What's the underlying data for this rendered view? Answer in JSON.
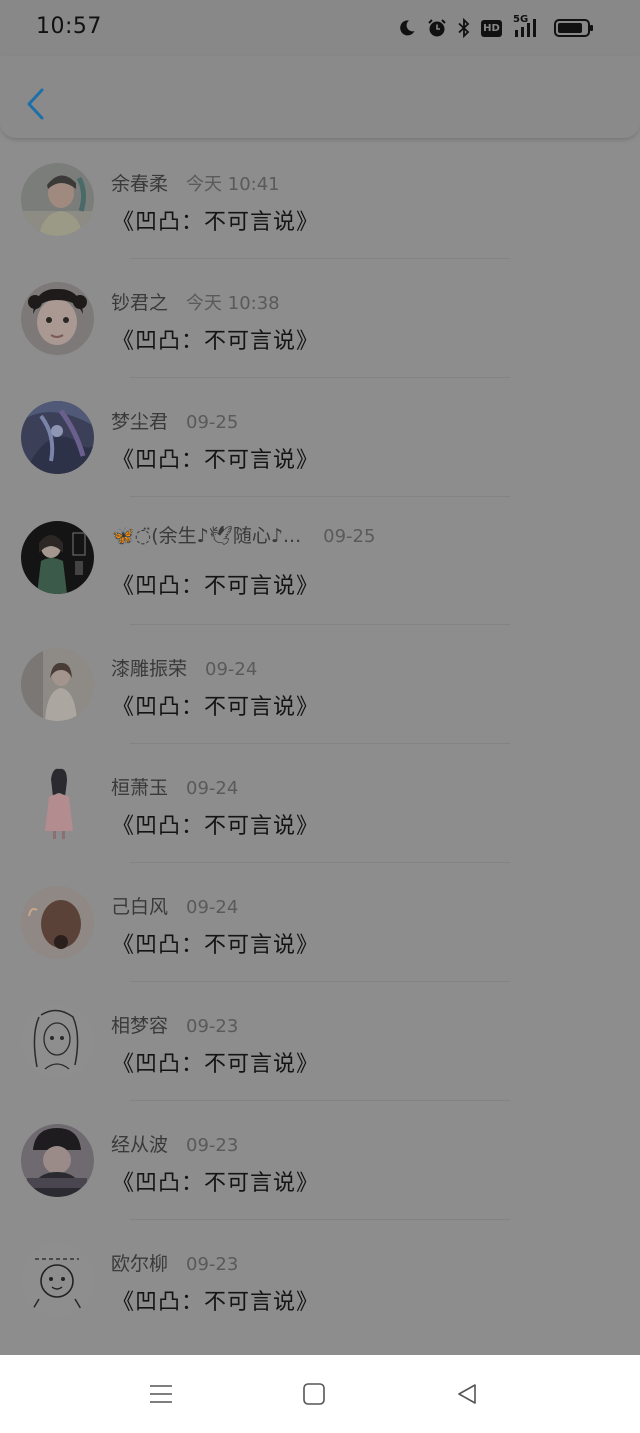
{
  "status_bar": {
    "time": "10:57",
    "icons": [
      "moon-icon",
      "alarm-clock-icon",
      "bluetooth-icon",
      "hd-icon",
      "5g-signal-icon",
      "battery-icon"
    ],
    "hd_label": "HD",
    "network_label": "5G"
  },
  "header": {
    "back_icon": "chevron-left-icon",
    "accent_color": "#1c6fa8"
  },
  "message_list": [
    {
      "name": "余春柔",
      "time": "今天 10:41",
      "message": "《凹凸：不可言说》",
      "avatar": "avatar-boy-sweater"
    },
    {
      "name": "钞君之",
      "time": "今天 10:38",
      "message": "《凹凸：不可言说》",
      "avatar": "avatar-child-portrait"
    },
    {
      "name": "梦尘君",
      "time": "09-25",
      "message": "《凹凸：不可言说》",
      "avatar": "avatar-fantasy-art"
    },
    {
      "name": "🦋◌̈(余生♪🕊随心♪...",
      "time": "09-25",
      "message": "《凹凸：不可言说》",
      "avatar": "avatar-girl-green-dress"
    },
    {
      "name": "漆雕振荣",
      "time": "09-24",
      "message": "《凹凸：不可言说》",
      "avatar": "avatar-woman-room"
    },
    {
      "name": "桓萧玉",
      "time": "09-24",
      "message": "《凹凸：不可言说》",
      "avatar": "avatar-girl-pink-dress"
    },
    {
      "name": "己白风",
      "time": "09-24",
      "message": "《凹凸：不可言说》",
      "avatar": "avatar-hair-back"
    },
    {
      "name": "相梦容",
      "time": "09-23",
      "message": "《凹凸：不可言说》",
      "avatar": "avatar-sketch-girl"
    },
    {
      "name": "经从波",
      "time": "09-23",
      "message": "《凹凸：不可言说》",
      "avatar": "avatar-girl-hat"
    },
    {
      "name": "欧尔柳",
      "time": "09-23",
      "message": "《凹凸：不可言说》",
      "avatar": "avatar-doodle"
    }
  ],
  "nav_bar": {
    "buttons": [
      "menu-icon",
      "home-icon",
      "back-triangle-icon"
    ]
  }
}
